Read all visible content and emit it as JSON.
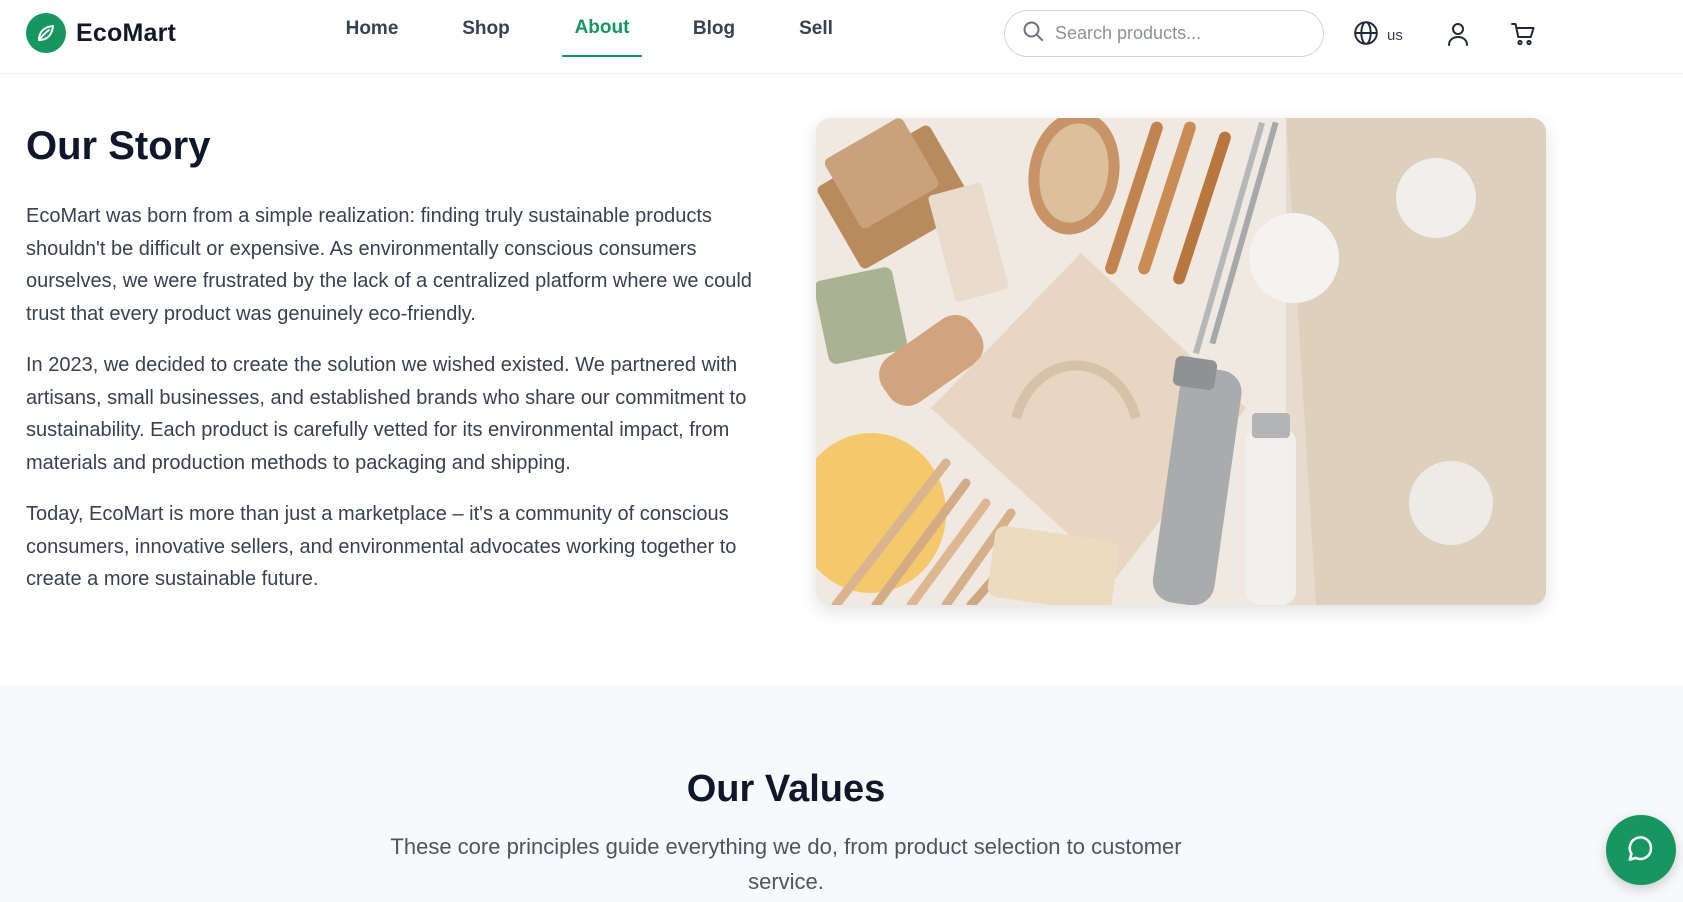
{
  "brand": {
    "name": "EcoMart",
    "accent_color": "#16975f",
    "logo_icon": "leaf-icon"
  },
  "nav": {
    "items": [
      {
        "label": "Home",
        "active": false
      },
      {
        "label": "Shop",
        "active": false
      },
      {
        "label": "About",
        "active": true
      },
      {
        "label": "Blog",
        "active": false
      },
      {
        "label": "Sell",
        "active": false
      }
    ]
  },
  "search": {
    "placeholder": "Search products...",
    "value": "",
    "icon": "search-icon"
  },
  "locale": {
    "label": "us",
    "icon": "globe-icon"
  },
  "account": {
    "icon": "user-icon"
  },
  "cart": {
    "icon": "cart-icon"
  },
  "story": {
    "title": "Our Story",
    "paragraphs": [
      "EcoMart was born from a simple realization: finding truly sustainable products shouldn't be difficult or expensive. As environmentally conscious consumers ourselves, we were frustrated by the lack of a centralized platform where we could trust that every product was genuinely eco-friendly.",
      "In 2023, we decided to create the solution we wished existed. We partnered with artisans, small businesses, and established brands who share our commitment to sustainability. Each product is carefully vetted for its environmental impact, from materials and production methods to packaging and shipping.",
      "Today, EcoMart is more than just a marketplace – it's a community of conscious consumers, innovative sellers, and environmental advocates working together to create a more sustainable future."
    ],
    "image_subject": "flat lay of zero-waste products"
  },
  "values": {
    "title": "Our Values",
    "subtitle": "These core principles guide everything we do, from product selection to customer service."
  },
  "chat": {
    "icon": "chat-bubble-icon"
  }
}
